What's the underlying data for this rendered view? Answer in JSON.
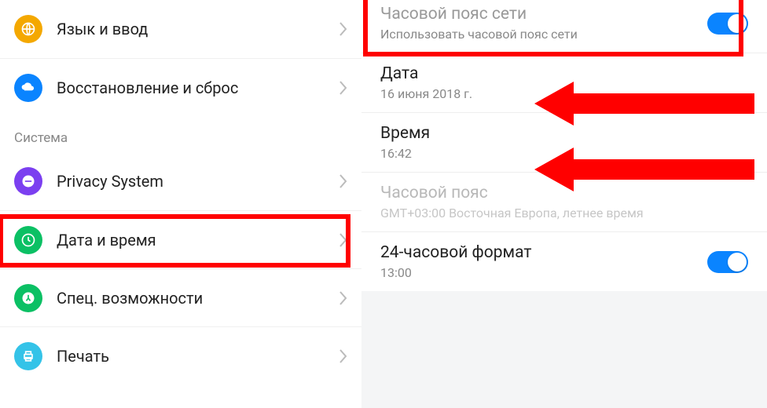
{
  "left": {
    "items": [
      {
        "label": "Язык и ввод",
        "iconColor": "#f4a800"
      },
      {
        "label": "Восстановление и сброс",
        "iconColor": "#0a84ff"
      }
    ],
    "section": "Система",
    "sysItems": [
      {
        "label": "Privacy System",
        "iconColor": "#7b3ff0"
      },
      {
        "label": "Дата и время",
        "iconColor": "#0bc064"
      },
      {
        "label": "Спец. возможности",
        "iconColor": "#0bc064"
      },
      {
        "label": "Печать",
        "iconColor": "#34c3e8"
      }
    ]
  },
  "right": {
    "netTz": {
      "title": "Часовой пояс сети",
      "sub": "Использовать часовой пояс сети",
      "on": true
    },
    "date": {
      "title": "Дата",
      "sub": "16 июня 2018 г."
    },
    "time": {
      "title": "Время",
      "sub": "16:42"
    },
    "tz": {
      "title": "Часовой пояс",
      "sub": "GMT+03:00 Восточная Европа, летнее время"
    },
    "fmt24": {
      "title": "24-часовой формат",
      "sub": "13:00",
      "on": true
    }
  }
}
